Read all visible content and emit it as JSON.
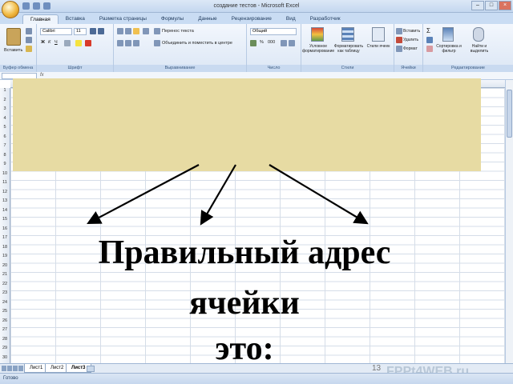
{
  "window": {
    "title": "создание тестов - Microsoft Excel",
    "controls": [
      "–",
      "□",
      "×"
    ]
  },
  "ribbon": {
    "tabs": [
      "Главная",
      "Вставка",
      "Разметка страницы",
      "Формулы",
      "Данные",
      "Рецензирование",
      "Вид",
      "Разработчик"
    ],
    "active_tab": "Главная",
    "groups": {
      "clipboard": {
        "label": "Буфер обмена",
        "paste": "Вставить"
      },
      "font": {
        "label": "Шрифт",
        "font_name": "Calibri",
        "font_size": "11"
      },
      "alignment": {
        "label": "Выравнивание",
        "wrap": "Перенос текста",
        "merge": "Объединить и поместить в центре"
      },
      "number": {
        "label": "Число",
        "format": "Общий"
      },
      "styles": {
        "label": "Стили",
        "cond": "Условное форматирование",
        "table": "Форматировать как таблицу",
        "cell": "Стили ячеек"
      },
      "cells": {
        "label": "Ячейки",
        "insert": "Вставить",
        "delete": "Удалить",
        "format": "Формат"
      },
      "editing": {
        "label": "Редактирование",
        "sort": "Сортировка и фильтр",
        "find": "Найти и выделить"
      }
    }
  },
  "grid": {
    "rows": [
      "1",
      "2",
      "3",
      "4",
      "5",
      "6",
      "7",
      "8",
      "9",
      "10",
      "11",
      "12",
      "13",
      "14",
      "15",
      "16",
      "17",
      "18",
      "19",
      "20",
      "21",
      "22",
      "23",
      "24",
      "25",
      "26",
      "27",
      "28",
      "29",
      "30"
    ]
  },
  "slide": {
    "line1": "Правильный адрес",
    "line2": "ячейки",
    "line3": "это:"
  },
  "sheets": [
    "Лист1",
    "Лист2",
    "Лист3"
  ],
  "active_sheet": "Лист3",
  "page_number": "13",
  "watermark": "FPPt4WEB.ru",
  "status": "Готово"
}
